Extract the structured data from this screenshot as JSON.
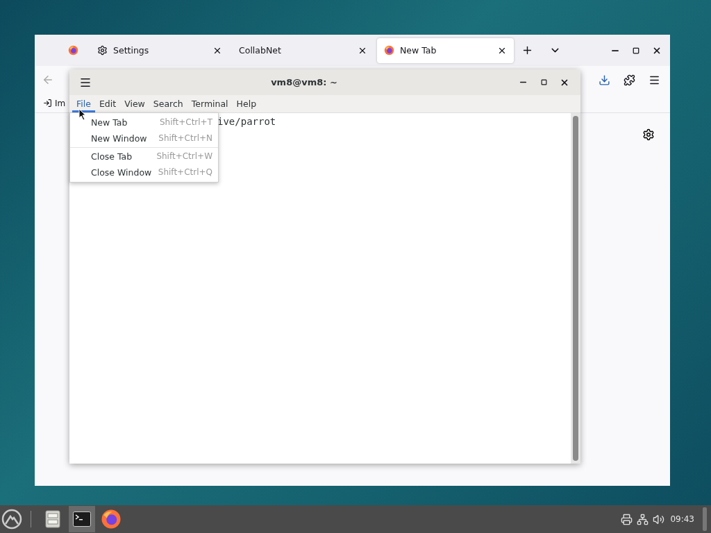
{
  "browser": {
    "tabs": [
      {
        "kind": "pinned",
        "selected": false
      },
      {
        "kind": "settings",
        "label": "Settings",
        "selected": false
      },
      {
        "kind": "plain",
        "label": "CollabNet",
        "selected": false
      },
      {
        "kind": "firefox",
        "label": "New Tab",
        "selected": true
      }
    ],
    "bookmarks": [
      {
        "label": "Im"
      }
    ]
  },
  "terminal": {
    "title": "vm8@vm8: ~",
    "menus": [
      {
        "label": "File",
        "selected": true
      },
      {
        "label": "Edit",
        "selected": false
      },
      {
        "label": "View",
        "selected": false
      },
      {
        "label": "Search",
        "selected": false
      },
      {
        "label": "Terminal",
        "selected": false
      },
      {
        "label": "Help",
        "selected": false
      }
    ],
    "lines": [
      "ive/parrot"
    ],
    "file_menu": [
      [
        {
          "label": "New Tab",
          "shortcut": "Shift+Ctrl+T"
        },
        {
          "label": "New Window",
          "shortcut": "Shift+Ctrl+N"
        }
      ],
      [
        {
          "label": "Close Tab",
          "shortcut": "Shift+Ctrl+W"
        },
        {
          "label": "Close Window",
          "shortcut": "Shift+Ctrl+Q"
        }
      ]
    ]
  },
  "taskbar": {
    "apps": [
      {
        "kind": "files",
        "active": false
      },
      {
        "kind": "terminal",
        "active": true
      },
      {
        "kind": "firefox",
        "active": false
      }
    ],
    "clock": "09:43"
  }
}
